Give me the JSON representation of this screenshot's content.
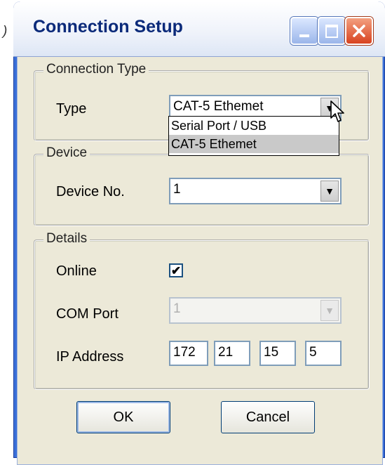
{
  "window": {
    "title": "Connection Setup"
  },
  "stray_glyph": ")",
  "connection_type": {
    "group_label": "Connection Type",
    "type_label": "Type",
    "type_value": "CAT-5 Ethemet",
    "options": [
      "Serial Port / USB",
      "CAT-5 Ethemet"
    ],
    "selected_index": 1
  },
  "device": {
    "group_label": "Device",
    "device_no_label": "Device No.",
    "device_no_value": "1"
  },
  "details": {
    "group_label": "Details",
    "online_label": "Online",
    "online_checked": true,
    "com_port_label": "COM Port",
    "com_port_value": "1",
    "ip_label": "IP Address",
    "ip": [
      "172",
      "21",
      "15",
      "5"
    ]
  },
  "buttons": {
    "ok": "OK",
    "cancel": "Cancel"
  },
  "icons": {
    "minimize": "minimize-icon",
    "maximize": "maximize-icon",
    "close": "close-icon",
    "dropdown_arrow": "chevron-down-icon",
    "checkmark": "checkmark-icon",
    "cursor": "mouse-pointer-icon"
  },
  "colors": {
    "titlebar_text": "#0b2a7a",
    "close_button": "#d8421f",
    "dialog_bg": "#ece9d8",
    "selection_bg": "#c9c9c9"
  }
}
